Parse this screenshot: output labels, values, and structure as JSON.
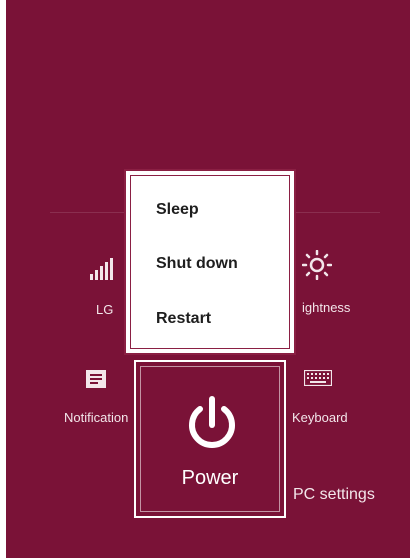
{
  "colors": {
    "panel": "#7a1237",
    "menu_border": "#8a1f43",
    "menu_bg": "#ffffff"
  },
  "tiles": {
    "network": {
      "label": "LG",
      "icon": "signal-bars-icon"
    },
    "brightness": {
      "label": "ightness",
      "icon": "sun-icon"
    },
    "notifications": {
      "label": "Notification",
      "icon": "notification-icon"
    },
    "keyboard": {
      "label": "Keyboard",
      "icon": "keyboard-icon"
    }
  },
  "pc_settings": "PC settings",
  "power": {
    "label": "Power",
    "icon": "power-icon"
  },
  "power_menu": {
    "items": [
      "Sleep",
      "Shut down",
      "Restart"
    ]
  }
}
